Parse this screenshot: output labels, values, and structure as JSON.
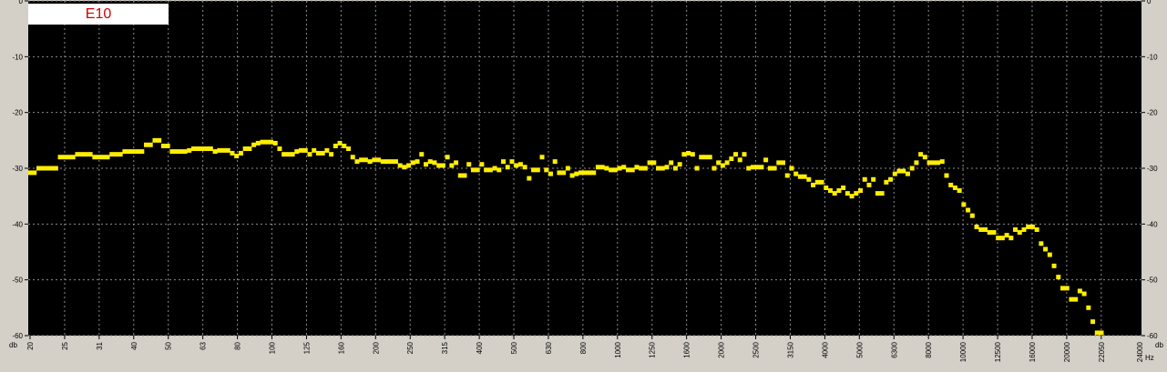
{
  "chart_data": {
    "type": "scatter",
    "title": "E10",
    "ylabel_left": "db",
    "ylabel_right": "db",
    "xunit": "Hz",
    "xlast_tick": "24000",
    "ylim": [
      -60,
      0
    ],
    "yticks": [
      0,
      -10,
      -20,
      -30,
      -40,
      -50,
      -60
    ],
    "xticks": [
      "20",
      "25",
      "31",
      "40",
      "50",
      "63",
      "80",
      "100",
      "125",
      "160",
      "200",
      "250",
      "315",
      "400",
      "500",
      "630",
      "800",
      "1000",
      "1250",
      "1600",
      "2000",
      "2500",
      "3150",
      "4000",
      "5000",
      "6300",
      "8000",
      "10000",
      "12500",
      "16000",
      "20000",
      "22050"
    ],
    "grid": true,
    "point_color": "#ffee00",
    "series": [
      {
        "values": [
          -30.8,
          -30.8,
          -30.0,
          -30.0,
          -30.0,
          -30.0,
          -30.0,
          -28.0,
          -28.0,
          -28.0,
          -28.0,
          -27.5,
          -27.5,
          -27.5,
          -27.5,
          -28.0,
          -28.0,
          -28.0,
          -28.0,
          -27.5,
          -27.5,
          -27.5,
          -27.0,
          -27.0,
          -27.0,
          -27.0,
          -27.0,
          -25.8,
          -25.8,
          -25.0,
          -25.0,
          -26.0,
          -26.0,
          -27.0,
          -27.0,
          -27.0,
          -27.0,
          -26.8,
          -26.5,
          -26.5,
          -26.5,
          -26.5,
          -26.5,
          -27.0,
          -26.8,
          -26.8,
          -26.8,
          -27.3,
          -27.8,
          -27.3,
          -26.5,
          -26.5,
          -25.8,
          -25.5,
          -25.3,
          -25.3,
          -25.3,
          -25.5,
          -26.5,
          -27.5,
          -27.5,
          -27.5,
          -27.0,
          -26.8,
          -26.8,
          -27.5,
          -26.8,
          -27.3,
          -27.3,
          -26.8,
          -27.5,
          -26.0,
          -25.5,
          -26.0,
          -26.5,
          -28.0,
          -28.8,
          -28.5,
          -28.5,
          -28.8,
          -28.5,
          -28.5,
          -28.8,
          -28.8,
          -28.8,
          -28.8,
          -29.5,
          -29.8,
          -29.5,
          -29.0,
          -28.8,
          -27.5,
          -29.3,
          -28.8,
          -29.0,
          -29.5,
          -29.5,
          -28.0,
          -29.5,
          -29.0,
          -31.3,
          -31.3,
          -29.3,
          -30.3,
          -30.3,
          -29.3,
          -30.3,
          -30.3,
          -30.0,
          -30.3,
          -28.8,
          -29.8,
          -28.8,
          -29.5,
          -29.3,
          -29.8,
          -31.8,
          -30.3,
          -30.3,
          -28.0,
          -30.3,
          -31.0,
          -28.8,
          -30.8,
          -30.8,
          -30.0,
          -31.3,
          -31.0,
          -30.8,
          -30.8,
          -30.8,
          -30.8,
          -29.8,
          -29.8,
          -30.0,
          -30.3,
          -30.3,
          -30.0,
          -29.8,
          -30.3,
          -30.3,
          -29.8,
          -30.0,
          -30.0,
          -29.0,
          -29.0,
          -30.0,
          -30.0,
          -29.8,
          -29.0,
          -30.0,
          -29.3,
          -27.5,
          -27.3,
          -27.5,
          -30.0,
          -28.0,
          -28.0,
          -28.0,
          -30.0,
          -29.0,
          -29.5,
          -29.0,
          -28.3,
          -27.5,
          -28.5,
          -27.5,
          -30.0,
          -29.8,
          -29.8,
          -29.8,
          -28.5,
          -30.0,
          -30.0,
          -29.0,
          -29.0,
          -31.3,
          -30.0,
          -31.0,
          -31.5,
          -31.5,
          -32.0,
          -33.0,
          -32.5,
          -32.5,
          -33.5,
          -34.0,
          -34.5,
          -34.0,
          -33.5,
          -34.5,
          -35.0,
          -34.5,
          -34.0,
          -32.0,
          -33.0,
          -32.0,
          -34.5,
          -34.5,
          -32.5,
          -32.0,
          -31.0,
          -30.5,
          -30.5,
          -31.0,
          -30.0,
          -29.0,
          -27.5,
          -28.0,
          -29.0,
          -29.0,
          -29.0,
          -28.8,
          -31.3,
          -33.0,
          -33.5,
          -34.0,
          -36.5,
          -37.5,
          -38.5,
          -40.5,
          -41.0,
          -41.0,
          -41.5,
          -41.5,
          -42.5,
          -42.5,
          -42.0,
          -42.5,
          -41.0,
          -41.5,
          -41.0,
          -40.5,
          -40.5,
          -41.0,
          -43.5,
          -44.5,
          -45.5,
          -47.5,
          -49.5,
          -51.5,
          -51.5,
          -53.5,
          -53.5,
          -52.0,
          -52.5,
          -55.0,
          -57.5,
          -59.5,
          -59.5
        ]
      }
    ]
  }
}
